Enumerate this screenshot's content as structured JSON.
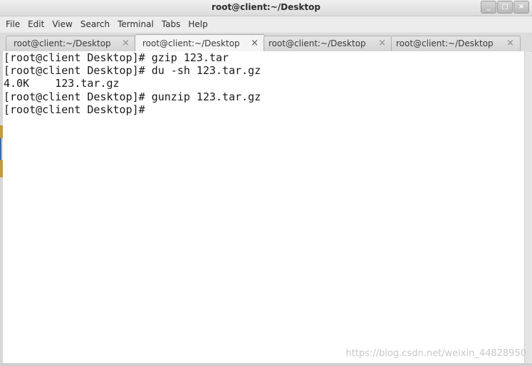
{
  "window": {
    "title": "root@client:~/Desktop",
    "controls": {
      "minimize": "_",
      "maximize": "□",
      "close": "×"
    }
  },
  "menu": {
    "items": [
      "File",
      "Edit",
      "View",
      "Search",
      "Terminal",
      "Tabs",
      "Help"
    ]
  },
  "tabs": [
    {
      "label": "root@client:~/Desktop",
      "close": "×",
      "active": false
    },
    {
      "label": "root@client:~/Desktop",
      "close": "×",
      "active": true
    },
    {
      "label": "root@client:~/Desktop",
      "close": "×",
      "active": false
    },
    {
      "label": "root@client:~/Desktop",
      "close": "×",
      "active": false
    }
  ],
  "terminal": {
    "lines": [
      "[root@client Desktop]# gzip 123.tar",
      "[root@client Desktop]# du -sh 123.tar.gz",
      "4.0K\t123.tar.gz",
      "[root@client Desktop]# gunzip 123.tar.gz",
      "[root@client Desktop]# "
    ]
  },
  "watermark": "https://blog.csdn.net/weixin_44828950"
}
